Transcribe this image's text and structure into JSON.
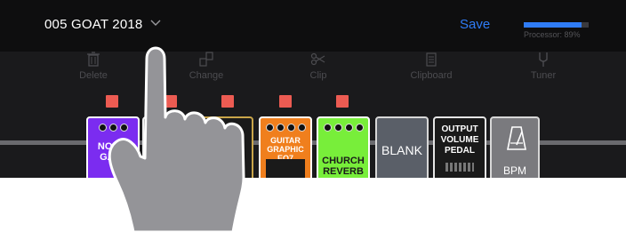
{
  "header": {
    "preset_name": "005 GOAT 2018",
    "save_label": "Save",
    "processor_label": "Processor: 89%",
    "processor_value": 0.89,
    "accent_color": "#2f7cf6"
  },
  "toolbar": {
    "items": [
      {
        "label": "Delete",
        "icon": "trash-icon"
      },
      {
        "label": "Change",
        "icon": "swap-icon"
      },
      {
        "label": "Clip",
        "icon": "scissors-icon"
      },
      {
        "label": "Clipboard",
        "icon": "clipboard-icon"
      },
      {
        "label": "Tuner",
        "icon": "tuner-fork-icon"
      }
    ]
  },
  "chain": {
    "pedals": [
      {
        "name": "NOISE GATE",
        "color": "#7b2cf0"
      },
      {
        "name": "",
        "color": "#111111"
      },
      {
        "name": "",
        "color": "#1a1a1a"
      },
      {
        "name": "GUITAR GRAPHIC EQ7",
        "color": "#f07f1d"
      },
      {
        "name": "CHURCH REVERB",
        "color": "#78ee3a"
      },
      {
        "name": "BLANK",
        "color": "#5a5f68"
      },
      {
        "name": "OUTPUT VOLUME PEDAL",
        "color": "#1a1a1a"
      },
      {
        "name": "BPM",
        "color": "#7a7a7e"
      }
    ],
    "selector_color": "#ec5b52"
  },
  "overlay": {
    "hand_icon": "pointing-hand-icon"
  }
}
